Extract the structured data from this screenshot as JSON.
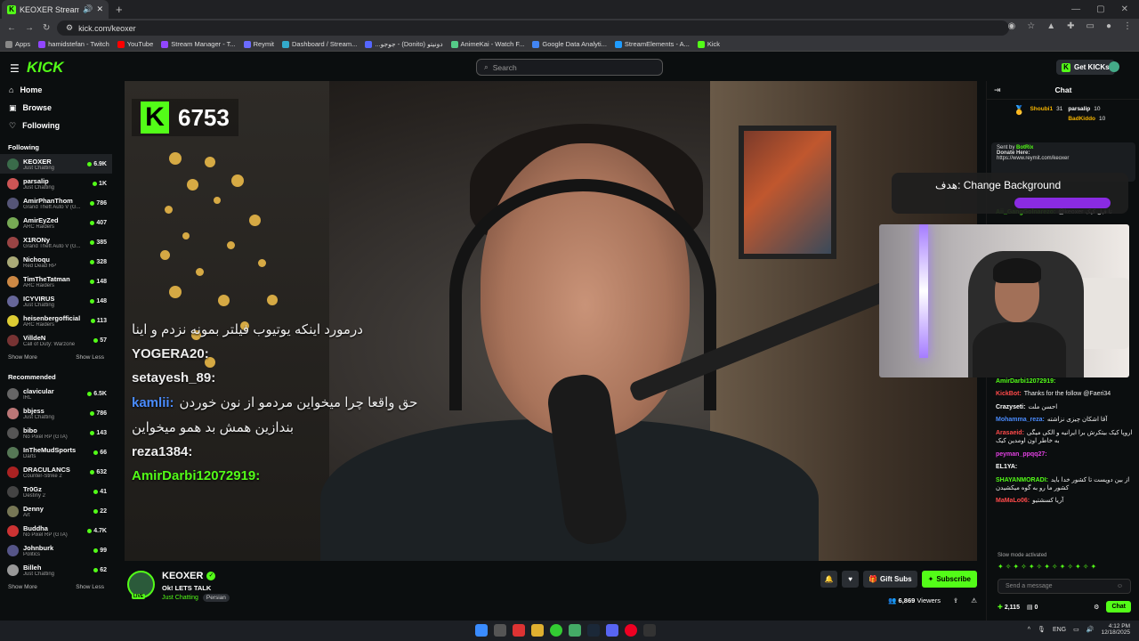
{
  "browser": {
    "tab_title": "KEOXER Stream - Watch Li",
    "url": "kick.com/keoxer",
    "bookmarks": [
      {
        "label": "Apps",
        "color": "#888888"
      },
      {
        "label": "hamidstefan - Twitch",
        "color": "#9146ff"
      },
      {
        "label": "YouTube",
        "color": "#ff0000"
      },
      {
        "label": "Stream Manager - T...",
        "color": "#9146ff"
      },
      {
        "label": "Reymit",
        "color": "#6b6bff"
      },
      {
        "label": "Dashboard / Stream...",
        "color": "#3ac"
      },
      {
        "label": "...جوجو - (Donito) دونیتو",
        "color": "#5566ff"
      },
      {
        "label": "AnimeKai - Watch F...",
        "color": "#55cc88"
      },
      {
        "label": "Google Data Analyti...",
        "color": "#4285f4"
      },
      {
        "label": "StreamElements - A...",
        "color": "#1f9cff"
      },
      {
        "label": "Kick",
        "color": "#53fc18"
      }
    ]
  },
  "header": {
    "logo": "KICK",
    "search_placeholder": "Search",
    "get_kicks": "Get KICKs"
  },
  "sidebar": {
    "nav": [
      {
        "label": "Home",
        "icon": "⌂"
      },
      {
        "label": "Browse",
        "icon": "▣"
      },
      {
        "label": "Following",
        "icon": "♡"
      }
    ],
    "following_title": "Following",
    "following": [
      {
        "name": "KEOXER",
        "category": "Just Chatting",
        "viewers": "6.9K",
        "color": "#3a6b4a"
      },
      {
        "name": "parsalip",
        "category": "Just Chatting",
        "viewers": "1K",
        "color": "#c55"
      },
      {
        "name": "AmirPhanThom",
        "category": "Grand Theft Auto V (G...",
        "viewers": "786",
        "color": "#557"
      },
      {
        "name": "AmirEyZed",
        "category": "ARC Raiders",
        "viewers": "407",
        "color": "#7a5"
      },
      {
        "name": "X1RONy",
        "category": "Grand Theft Auto V (G...",
        "viewers": "385",
        "color": "#944"
      },
      {
        "name": "Nichoqu",
        "category": "Red Dead RP",
        "viewers": "328",
        "color": "#aa7"
      },
      {
        "name": "TimTheTatman",
        "category": "ARC Raiders",
        "viewers": "148",
        "color": "#c84"
      },
      {
        "name": "ICYVIRUS",
        "category": "Just Chatting",
        "viewers": "148",
        "color": "#669"
      },
      {
        "name": "heisenbergofficial",
        "category": "ARC Raiders",
        "viewers": "113",
        "color": "#dc3"
      },
      {
        "name": "VilldeN",
        "category": "Call of Duty: Warzone",
        "viewers": "57",
        "color": "#733"
      }
    ],
    "show_more": "Show More",
    "show_less": "Show Less",
    "recommended_title": "Recommended",
    "recommended": [
      {
        "name": "clavicular",
        "category": "IRL",
        "viewers": "6.5K",
        "color": "#666"
      },
      {
        "name": "bbjess",
        "category": "Just Chatting",
        "viewers": "786",
        "color": "#b77"
      },
      {
        "name": "bibo",
        "category": "No Pixel RP (GTA)",
        "viewers": "143",
        "color": "#555"
      },
      {
        "name": "InTheMudSports",
        "category": "Darts",
        "viewers": "66",
        "color": "#575"
      },
      {
        "name": "DRACULANCS",
        "category": "Counter-Strike 2",
        "viewers": "632",
        "color": "#a22"
      },
      {
        "name": "Tr0Gz",
        "category": "Destiny 2",
        "viewers": "41",
        "color": "#444"
      },
      {
        "name": "Denny",
        "category": "Art",
        "viewers": "22",
        "color": "#775"
      },
      {
        "name": "Buddha",
        "category": "No Pixel RP (GTA)",
        "viewers": "4.7K",
        "color": "#c33"
      },
      {
        "name": "Johnburk",
        "category": "Politics",
        "viewers": "99",
        "color": "#558"
      },
      {
        "name": "Billeh",
        "category": "Just Chatting",
        "viewers": "62",
        "color": "#999"
      }
    ]
  },
  "video": {
    "kick_count": "6753",
    "overlay_chat": [
      {
        "user": "",
        "text": "درمورد اینکه یوتیوب فیلتر بمونه نزدم و اینا",
        "color": "#eeeeee"
      },
      {
        "user": "YOGERA20:",
        "text": "",
        "color": "#eeeeee"
      },
      {
        "user": "setayesh_89:",
        "text": "",
        "color": "#eeeeee"
      },
      {
        "user": "kamlii:",
        "text": "حق واقعا چرا میخواین مردمو از نون خوردن",
        "color": "#4a8cff"
      },
      {
        "user": "",
        "text": "بندازین همش بد همو میخواین",
        "color": "#eeeeee"
      },
      {
        "user": "reza1384:",
        "text": "",
        "color": "#eeeeee"
      },
      {
        "user": "AmirDarbi12072919:",
        "text": "",
        "color": "#53fc18"
      }
    ]
  },
  "stream": {
    "streamer": "KEOXER",
    "title": "Ok! LETS TALK",
    "category": "Just Chatting",
    "tag": "Persian",
    "live_badge": "LIVE",
    "gift_subs": "Gift Subs",
    "subscribe": "Subscribe",
    "viewers": "6,869",
    "viewers_label": "Viewers"
  },
  "chat": {
    "title": "Chat",
    "top_gifters": [
      {
        "name": "Shoubi1",
        "count": "31"
      },
      {
        "name": "parsalip",
        "count": "10"
      },
      {
        "name": "BadKiddo",
        "count": "10"
      }
    ],
    "pinned_sender": "Sent by",
    "pinned_bot": "BotRix",
    "pinned_line1": "Donate Here:",
    "pinned_line2": "https://www.reymit.com/keoxer",
    "overlay_text": "هدف: Change Background",
    "messages": [
      {
        "user": "Aii_GangGolnarezo:",
        "text": "@keoxer تا قبل کیک",
        "color": "#53fc18"
      },
      {
        "user": "AmirDarbi12072919:",
        "text": "",
        "color": "#53fc18"
      },
      {
        "user": "KickBot:",
        "text": "Thanks for the follow @Faeri34",
        "color": "#ff4a4a"
      },
      {
        "user": "Crazyseti:",
        "text": "احسن ملت",
        "color": "#ffffff"
      },
      {
        "user": "Mohamma_reza:",
        "text": "آقا اشکان چیزی نزاشته",
        "color": "#4a8cff"
      },
      {
        "user": "Arasaeid:",
        "text": "اروپا کیک بیتکرش برا ایرانیه و الکی میگی به خاطر اون اومدین کیک",
        "color": "#ff4a4a"
      },
      {
        "user": "peyman_ppqq27:",
        "text": "",
        "color": "#e040e0"
      },
      {
        "user": "EL1YA:",
        "text": "",
        "color": "#ffffff"
      },
      {
        "user": "SHAYANMORADI:",
        "text": "از بین دوپست تا کشور خدا باید کشور ما رو به گوه میکشیدن",
        "color": "#53fc18"
      },
      {
        "user": "MaMaLo06:",
        "text": "آریا کسشتیو",
        "color": "#ff4a4a"
      }
    ],
    "slow_mode": "Slow mode activated",
    "input_placeholder": "Send a message",
    "points": "2,115",
    "subs": "0",
    "chat_button": "Chat"
  },
  "taskbar": {
    "lang": "ENG",
    "time": "4:12 PM",
    "date": "12/18/2025"
  }
}
